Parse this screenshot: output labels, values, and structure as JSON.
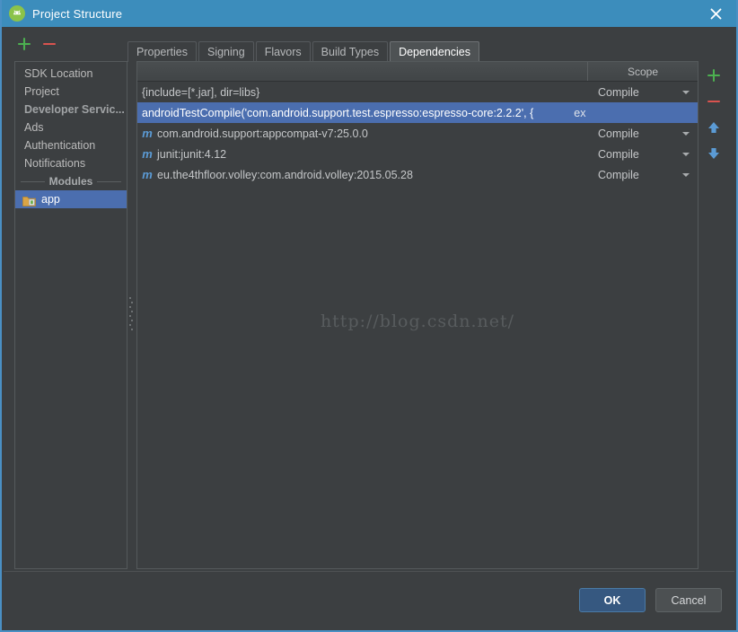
{
  "window": {
    "title": "Project Structure",
    "app_icon": "android-studio-icon",
    "close_icon": "close-icon"
  },
  "toolbar": {
    "add_icon": "plus-icon",
    "remove_icon": "minus-icon"
  },
  "tabs": [
    {
      "label": "Properties",
      "active": false
    },
    {
      "label": "Signing",
      "active": false
    },
    {
      "label": "Flavors",
      "active": false
    },
    {
      "label": "Build Types",
      "active": false
    },
    {
      "label": "Dependencies",
      "active": true
    }
  ],
  "sidebar": {
    "items": [
      {
        "label": "SDK Location",
        "type": "item",
        "selected": false
      },
      {
        "label": "Project",
        "type": "item",
        "selected": false
      },
      {
        "label": "Developer Servic...",
        "type": "group",
        "selected": false
      },
      {
        "label": "Ads",
        "type": "item",
        "selected": false
      },
      {
        "label": "Authentication",
        "type": "item",
        "selected": false
      },
      {
        "label": "Notifications",
        "type": "item",
        "selected": false
      }
    ],
    "separator_label": "Modules",
    "module": {
      "label": "app",
      "icon": "module-folder-icon",
      "selected": true
    }
  },
  "table": {
    "columns": [
      {
        "key": "name",
        "label": ""
      },
      {
        "key": "scope",
        "label": "Scope"
      }
    ],
    "rows": [
      {
        "icon": "",
        "name": "{include=[*.jar], dir=libs}",
        "scope": "Compile",
        "selected": false,
        "show_scope": true
      },
      {
        "icon": "",
        "name": "androidTestCompile('com.android.support.test.espresso:espresso-core:2.2.2', {",
        "scope": "",
        "selected": true,
        "show_scope": false,
        "trailing": "ex"
      },
      {
        "icon": "m",
        "name": "com.android.support:appcompat-v7:25.0.0",
        "scope": "Compile",
        "selected": false,
        "show_scope": true
      },
      {
        "icon": "m",
        "name": "junit:junit:4.12",
        "scope": "Compile",
        "selected": false,
        "show_scope": true
      },
      {
        "icon": "m",
        "name": "eu.the4thfloor.volley:com.android.volley:2015.05.28",
        "scope": "Compile",
        "selected": false,
        "show_scope": true
      }
    ]
  },
  "watermark": "http://blog.csdn.net/",
  "right_tools": [
    {
      "name": "add-dependency-button",
      "icon": "plus-icon",
      "color": "#4caf50"
    },
    {
      "name": "remove-dependency-button",
      "icon": "minus-icon",
      "color": "#d9534f"
    },
    {
      "name": "move-up-button",
      "icon": "arrow-up-icon",
      "color": "#5b9bd5"
    },
    {
      "name": "move-down-button",
      "icon": "arrow-down-icon",
      "color": "#5b9bd5"
    }
  ],
  "footer": {
    "ok_label": "OK",
    "cancel_label": "Cancel"
  },
  "colors": {
    "titlebar": "#3c8dbc",
    "background": "#3c3f41",
    "selection": "#4b6eaf",
    "accent_green": "#4caf50",
    "accent_red": "#d9534f",
    "accent_blue": "#5b9bd5"
  }
}
